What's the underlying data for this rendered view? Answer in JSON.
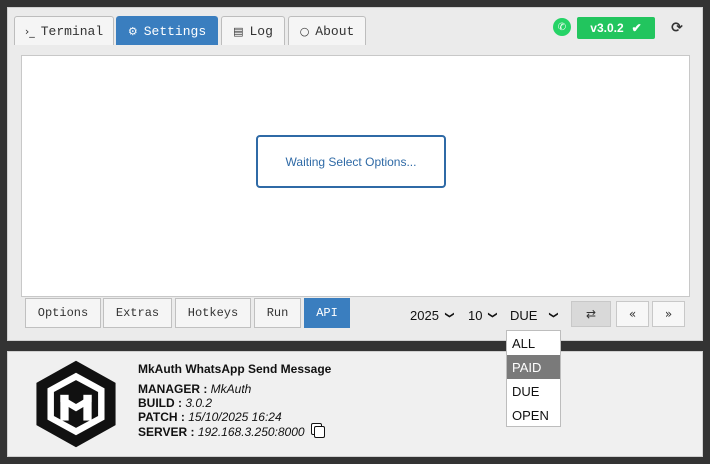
{
  "tabs": [
    {
      "label": "Terminal",
      "icon": "terminal-icon",
      "glyph": "›_",
      "active": false
    },
    {
      "label": "Settings",
      "icon": "gears-icon",
      "glyph": "⚙",
      "active": true
    },
    {
      "label": "Log",
      "icon": "list-icon",
      "glyph": "▤",
      "active": false
    },
    {
      "label": "About",
      "icon": "comment-icon",
      "glyph": "○",
      "active": false
    }
  ],
  "header": {
    "version": "v3.0.2",
    "check_glyph": "✔",
    "whatsapp_glyph": "✆",
    "refresh_glyph": "⟳"
  },
  "main": {
    "waiting_text": "Waiting Select Options..."
  },
  "bottom_tabs": [
    {
      "label": "Options",
      "active": false
    },
    {
      "label": "Extras",
      "active": false
    },
    {
      "label": "Hotkeys",
      "active": false
    },
    {
      "label": "Run",
      "active": false
    },
    {
      "label": "API",
      "active": true
    }
  ],
  "filters": {
    "year": "2025",
    "month": "10",
    "status": "DUE",
    "chevron": "❯"
  },
  "buttons": {
    "retweet_glyph": "⇄",
    "prev_glyph": "«",
    "next_glyph": "»"
  },
  "status_dropdown": {
    "options": [
      "ALL",
      "PAID",
      "DUE",
      "OPEN"
    ],
    "highlighted": "PAID"
  },
  "about": {
    "title": "MkAuth WhatsApp Send Message",
    "manager_label": "MANAGER :",
    "manager_value": "MkAuth",
    "build_label": "BUILD :",
    "build_value": "3.0.2",
    "patch_label": "PATCH :",
    "patch_value": "15/10/2025 16:24",
    "server_label": "SERVER :",
    "server_value": "192.168.3.250:8000"
  },
  "colors": {
    "accent": "#3a7ebf",
    "version_green": "#22c55e",
    "whatsapp_green": "#25d366",
    "background": "#333333"
  }
}
